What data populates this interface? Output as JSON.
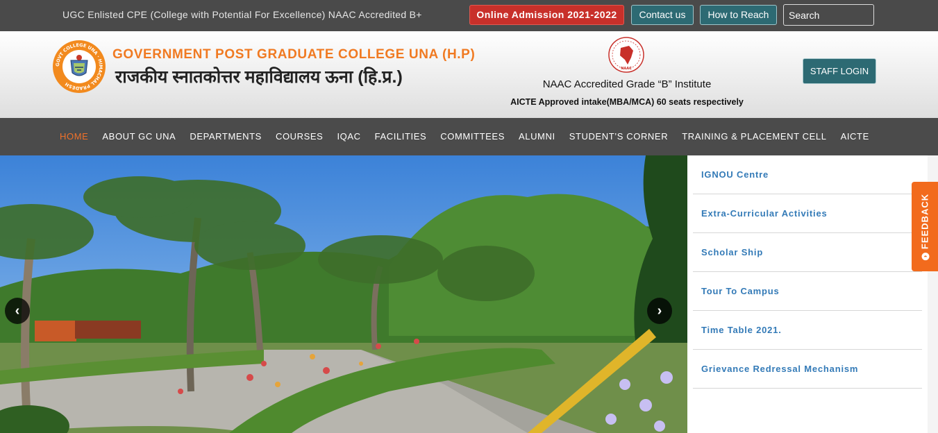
{
  "topbar": {
    "tagline": "UGC Enlisted CPE (College with Potential For Excellence) NAAC Accredited B+",
    "admission_label": "Online Admission 2021-2022",
    "contact_label": "Contact us",
    "reach_label": "How to Reach",
    "search_placeholder": "Search"
  },
  "header": {
    "college_name_en": "GOVERNMENT POST GRADUATE COLLEGE UNA (H.P)",
    "college_name_hi": "राजकीय स्नातकोत्तर महाविद्यालय ऊना (हि.प्र.)",
    "logo_ring_text": "GOVT COLLEGE UNA · HIMACHAL PRADESH",
    "naac_logo_text": "NAAC",
    "naac_text": "NAAC Accredited Grade “B” Institute",
    "aicte_text": "AICTE Approved intake(MBA/MCA) 60 seats respectively",
    "staff_login_label": "STAFF LOGIN"
  },
  "nav": {
    "items": [
      {
        "label": "HOME"
      },
      {
        "label": "ABOUT GC UNA"
      },
      {
        "label": "DEPARTMENTS"
      },
      {
        "label": "COURSES"
      },
      {
        "label": "IQAC"
      },
      {
        "label": "FACILITIES"
      },
      {
        "label": "COMMITTEES"
      },
      {
        "label": "ALUMNI"
      },
      {
        "label": "STUDENT’S CORNER"
      },
      {
        "label": "TRAINING & PLACEMENT CELL"
      },
      {
        "label": "AICTE"
      }
    ],
    "active_index": 0
  },
  "slider": {
    "prev_icon": "chevron-left-icon",
    "next_icon": "chevron-right-icon"
  },
  "quick_links": [
    {
      "label": "IGNOU Centre"
    },
    {
      "label": "Extra-Curricular Activities"
    },
    {
      "label": "Scholar Ship"
    },
    {
      "label": "Tour To Campus"
    },
    {
      "label": "Time Table 2021."
    },
    {
      "label": "Grievance Redressal Mechanism"
    }
  ],
  "feedback": {
    "label": "FEEDBACK",
    "icon": "circle-icon"
  },
  "colors": {
    "topbar_bg": "#4a4a4a",
    "admission_red": "#c8302a",
    "teal_button": "#2d6a73",
    "college_orange": "#f07a22",
    "nav_active": "#f0712a",
    "link_blue": "#337ab7",
    "feedback_orange": "#f26b1d"
  }
}
